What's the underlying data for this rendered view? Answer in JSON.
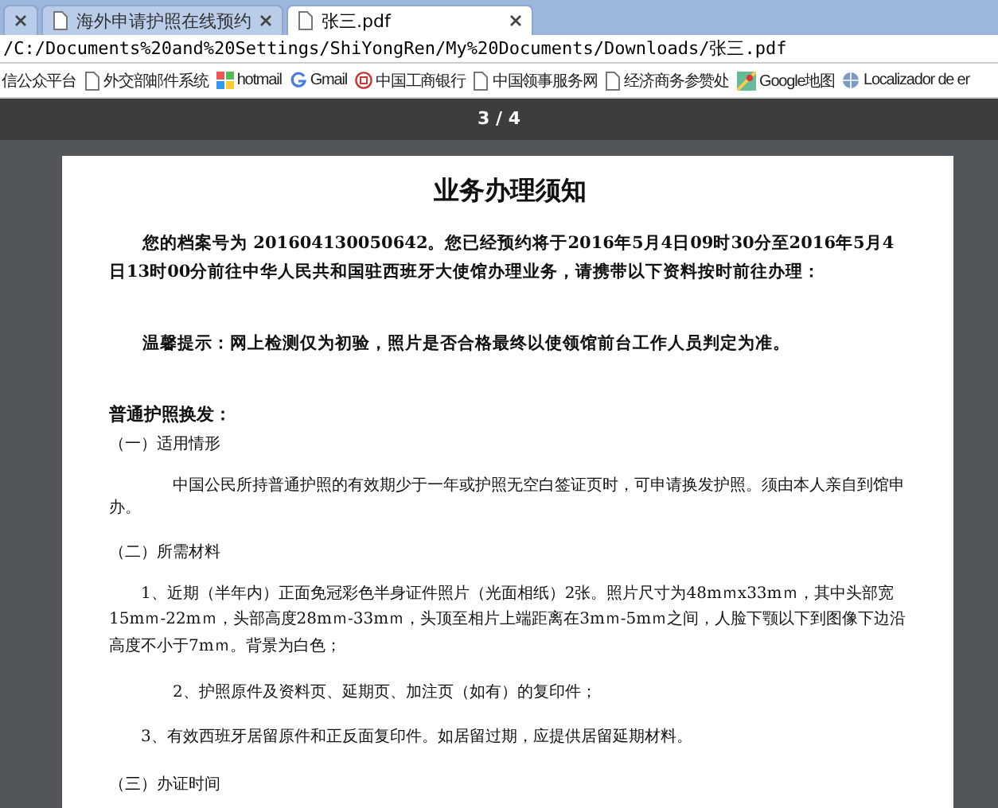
{
  "tabs": [
    {
      "selected": false
    },
    {
      "label": "海外申请护照在线预约",
      "selected": false
    },
    {
      "label": "张三.pdf",
      "selected": true
    }
  ],
  "address": "/C:/Documents%20and%20Settings/ShiYongRen/My%20Documents/Downloads/张三.pdf",
  "bookmarks": [
    {
      "label": "信公众平台",
      "kind": "plain"
    },
    {
      "label": "外交部邮件系统",
      "kind": "page"
    },
    {
      "label": "hotmail",
      "kind": "windows"
    },
    {
      "label": "Gmail",
      "kind": "google"
    },
    {
      "label": "中国工商银行",
      "kind": "bank"
    },
    {
      "label": "中国领事服务网",
      "kind": "page"
    },
    {
      "label": "经济商务参赞处",
      "kind": "page"
    },
    {
      "label": "Google地图",
      "kind": "map"
    },
    {
      "label": "Localizador de er",
      "kind": "globe"
    }
  ],
  "viewer": {
    "page_indicator": "3 / 4"
  },
  "document": {
    "title": "业务办理须知",
    "paragraphs": [
      {
        "kind": "notice",
        "text": "您的档案号为 201604130050642。您已经预约将于2016年5月4日09时30分至2016年5月4日13时00分前往中华人民共和国驻西班牙大使馆办理业务，请携带以下资料按时前往办理："
      },
      {
        "kind": "tip",
        "text": "温馨提示：网上检测仅为初验，照片是否合格最终以使领馆前台工作人员判定为准。"
      },
      {
        "kind": "heading",
        "text": "普通护照换发："
      },
      {
        "kind": "subheading",
        "text": "（一）适用情形"
      },
      {
        "kind": "body",
        "text": "中国公民所持普通护照的有效期少于一年或护照无空白签证页时，可申请换发护照。须由本人亲自到馆申办。"
      },
      {
        "kind": "subheading",
        "text": "（二）所需材料"
      },
      {
        "kind": "item",
        "text": "1、近期（半年内）正面免冠彩色半身证件照片（光面相纸）2张。照片尺寸为48mｍx33mｍ，其中头部宽15mｍ-22mｍ，头部高度28mｍ-33mｍ，头顶至相片上端距离在3mｍ-5mｍ之间，人脸下颚以下到图像下边沿高度不小于7mｍ。背景为白色；"
      },
      {
        "kind": "item_deep",
        "text": "2、护照原件及资料页、延期页、加注页（如有）的复印件；"
      },
      {
        "kind": "item",
        "text": "3、有效西班牙居留原件和正反面复印件。如居留过期，应提供居留延期材料。"
      },
      {
        "kind": "subheading",
        "text": "（三）办证时间"
      }
    ]
  }
}
